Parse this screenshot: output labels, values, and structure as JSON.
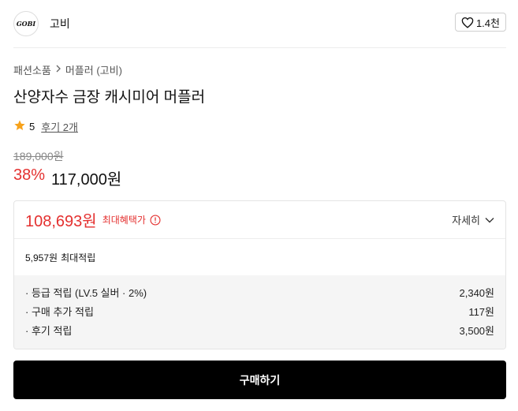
{
  "brand": {
    "logo_text": "GOBI",
    "name": "고비"
  },
  "like": {
    "count": "1.4천"
  },
  "breadcrumb": {
    "category": "패션소품",
    "subcategory": "머플러 (고비)"
  },
  "product": {
    "title": "산양자수 금장 캐시미어 머플러",
    "rating": "5",
    "review_link": "후기 2개",
    "original_price": "189,000원",
    "discount": "38%",
    "sale_price": "117,000원"
  },
  "benefit": {
    "best_price": "108,693원",
    "best_label": "최대혜택가",
    "detail_label": "자세히",
    "max_points": "5,957원",
    "max_points_label": "최대적립",
    "items": [
      {
        "label": "· 등급 적립 (LV.5 실버 · 2%)",
        "value": "2,340원"
      },
      {
        "label": "· 구매 추가 적립",
        "value": "117원"
      },
      {
        "label": "· 후기 적립",
        "value": "3,500원"
      }
    ]
  },
  "buy_button": {
    "label": "구매하기"
  },
  "colors": {
    "accent_red": "#e4302f",
    "star": "#f7a21b",
    "button_bg": "#000000"
  }
}
